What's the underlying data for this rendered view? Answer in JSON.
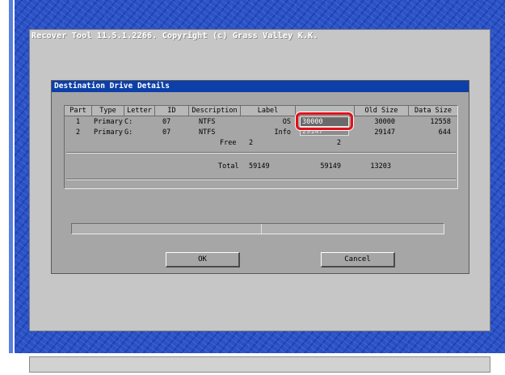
{
  "window": {
    "title": "Recover Tool 11.5.1.2266.  Copyright (c) Grass Valley K.K."
  },
  "dialog": {
    "title": "Destination Drive Details",
    "columns": [
      "Part",
      "Type",
      "Letter",
      "ID",
      "Description",
      "Label",
      "",
      "Old Size",
      "Data Size"
    ],
    "rows": [
      {
        "part": "1",
        "type": "Primary",
        "letter": "C:",
        "id": "07",
        "description": "NTFS",
        "label": "OS",
        "new_size": "30000",
        "old_size": "30000",
        "data_size": "12558"
      },
      {
        "part": "2",
        "type": "Primary",
        "letter": "G:",
        "id": "07",
        "description": "NTFS",
        "label": "Info",
        "new_size": "29147",
        "old_size": "29147",
        "data_size": "644"
      }
    ],
    "free_label": "Free",
    "free_value": "2",
    "free_new_size": "2",
    "total_label": "Total",
    "total_size": "59149",
    "total_new_size": "59149",
    "total_data_size": "13203",
    "ok_label": "OK",
    "cancel_label": "Cancel"
  },
  "colors": {
    "desktop": "#2a52c8",
    "dialog_titlebar": "#0c3fa8",
    "highlight": "#e0101c"
  }
}
